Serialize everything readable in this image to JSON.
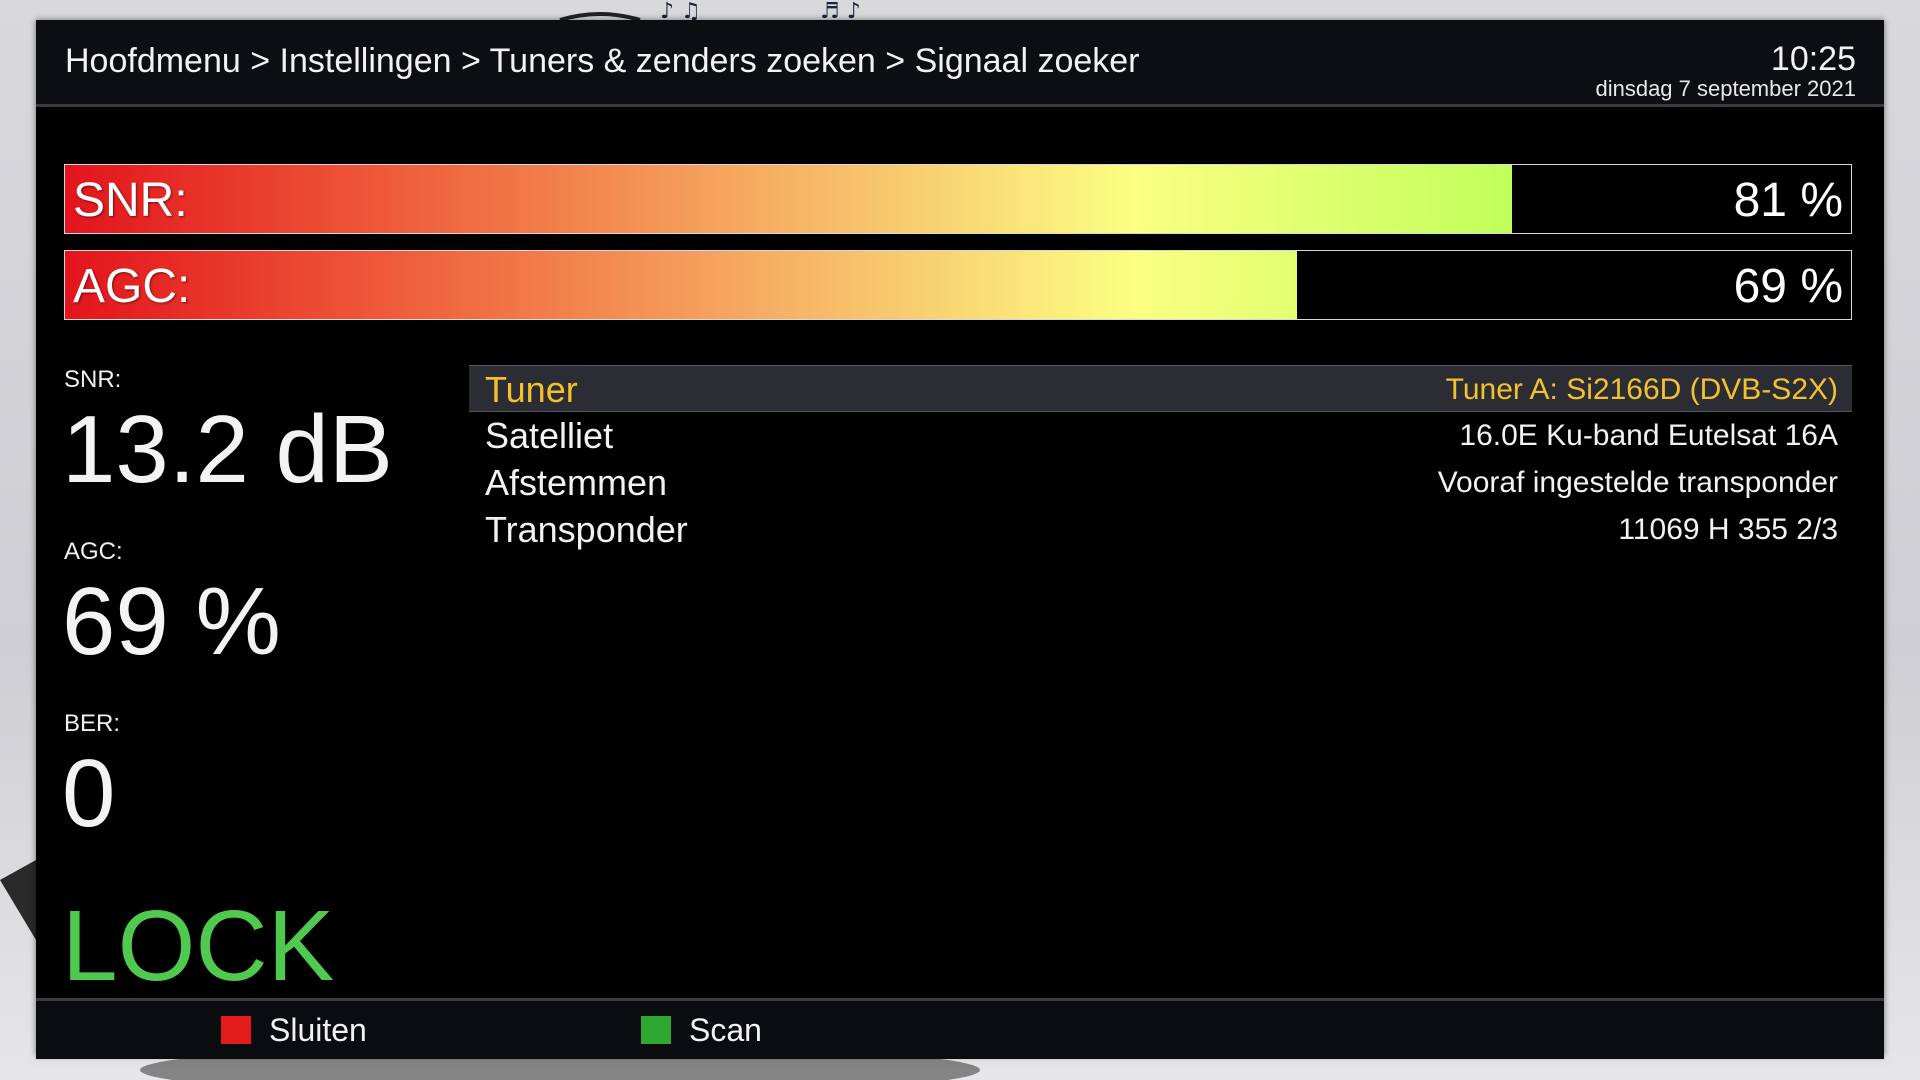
{
  "header": {
    "breadcrumb": "Hoofdmenu > Instellingen > Tuners & zenders zoeken > Signaal zoeker",
    "time": "10:25",
    "date": "dinsdag  7 september 2021"
  },
  "bars": {
    "snr": {
      "label": "SNR:",
      "value_text": "81 %",
      "level": 0.81
    },
    "agc": {
      "label": "AGC:",
      "value_text": "69 %",
      "level": 0.69
    }
  },
  "metrics": {
    "snr_label": "SNR:",
    "snr_value": "13.2 dB",
    "agc_label": "AGC:",
    "agc_value": "69 %",
    "ber_label": "BER:",
    "ber_value": "0",
    "lock_status": "LOCK"
  },
  "info": [
    {
      "key": "Tuner",
      "value": "Tuner A: Si2166D (DVB-S2X)",
      "selected": true
    },
    {
      "key": "Satelliet",
      "value": "16.0E Ku-band Eutelsat 16A",
      "selected": false
    },
    {
      "key": "Afstemmen",
      "value": "Vooraf ingestelde transponder",
      "selected": false
    },
    {
      "key": "Transponder",
      "value": "11069 H 355 2/3",
      "selected": false
    }
  ],
  "footer": {
    "red_label": "Sluiten",
    "green_label": "Scan"
  },
  "colors": {
    "highlight_text": "#f3c12e",
    "lock_green": "#4fca4f",
    "red_key": "#e31b1b",
    "green_key": "#2ea82e"
  }
}
